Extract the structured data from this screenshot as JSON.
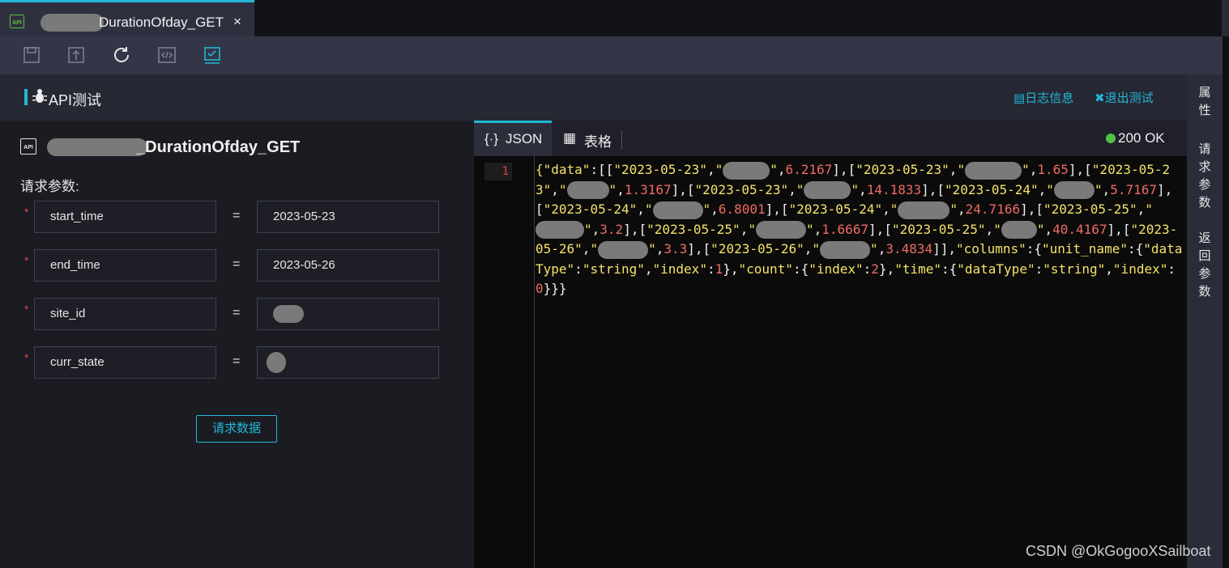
{
  "tab": {
    "title": "DurationOfday_GET",
    "close": "×",
    "icon_text": "API"
  },
  "toolbar": {
    "icons": [
      "save-icon",
      "upload-icon",
      "refresh-icon",
      "code-icon",
      "test-icon"
    ]
  },
  "header": {
    "title": "API测试",
    "log_link": "日志信息",
    "exit_link": "退出测试"
  },
  "side": {
    "props": "属性",
    "req_params": "请求参数",
    "resp_params": "返回参数"
  },
  "left": {
    "api_name": "_DurationOfday_GET",
    "params_label": "请求参数:",
    "params": [
      {
        "name": "start_time",
        "value": "2023-05-23"
      },
      {
        "name": "end_time",
        "value": "2023-05-26"
      },
      {
        "name": "site_id",
        "value": ""
      },
      {
        "name": "curr_state",
        "value": ""
      }
    ],
    "eq": "=",
    "submit": "请求数据"
  },
  "result": {
    "tab_json": "JSON",
    "tab_table": "表格",
    "status": "200 OK",
    "line_no": "1"
  },
  "watermark": "CSDN @OkGogooXSailboat",
  "colors": {
    "accent": "#22b7d6",
    "ok": "#4fc043",
    "required": "#e0453c"
  }
}
